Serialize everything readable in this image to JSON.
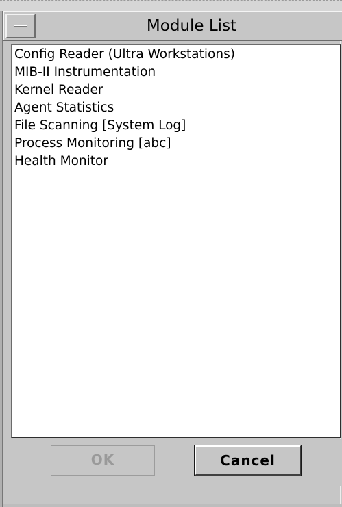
{
  "window": {
    "title": "Module List"
  },
  "module_list": {
    "items": [
      {
        "label": "Config Reader (Ultra Workstations)"
      },
      {
        "label": "MIB-II Instrumentation"
      },
      {
        "label": "Kernel Reader"
      },
      {
        "label": "Agent Statistics"
      },
      {
        "label": "File Scanning [System Log]"
      },
      {
        "label": "Process Monitoring [abc]"
      },
      {
        "label": "Health Monitor"
      }
    ]
  },
  "buttons": {
    "ok_label": "OK",
    "ok_enabled": false,
    "cancel_label": "Cancel"
  },
  "colors": {
    "chrome_gray": "#c6c6c6",
    "list_background": "#ffffff",
    "disabled_text": "#9a9a9a"
  },
  "icons": {
    "window_menu": "minus-icon"
  }
}
